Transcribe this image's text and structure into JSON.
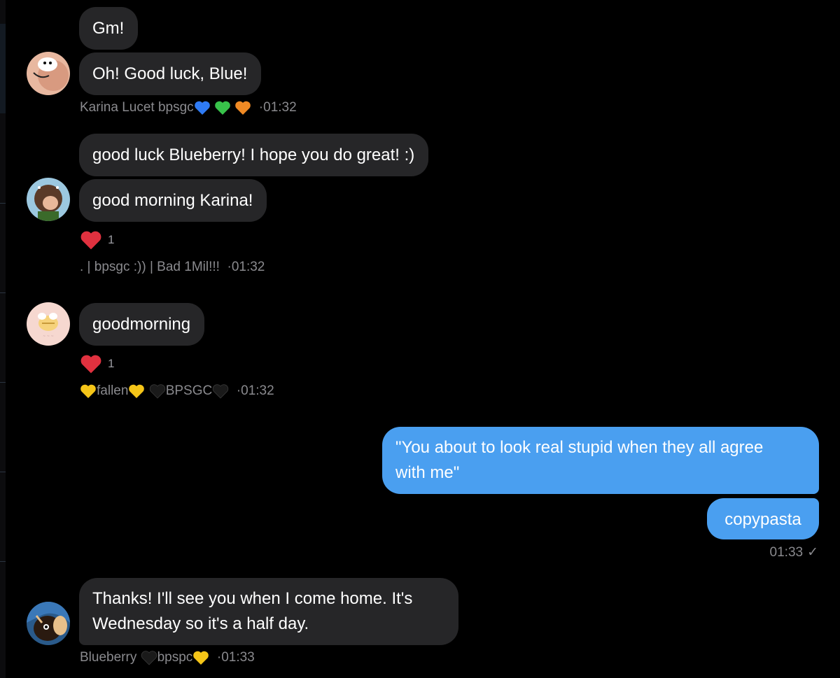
{
  "messages": [
    {
      "sender": "Karina Lucet bpsgc",
      "bubbles": [
        "Gm!",
        "Oh! Good luck, Blue!"
      ],
      "time": "01:32",
      "hearts": [
        "#2f7bf4",
        "#38c24a",
        "#f08a24"
      ]
    },
    {
      "sender": ". | bpsgc :)) | Bad 1Mil!!!",
      "bubbles": [
        "good luck Blueberry! I hope you do great! :)",
        "good morning Karina!"
      ],
      "reaction": {
        "emoji": "red-heart",
        "count": "1"
      },
      "time": "01:32"
    },
    {
      "sender_parts": [
        "fallen",
        "BPSGC"
      ],
      "bubbles": [
        "goodmorning"
      ],
      "reaction": {
        "emoji": "red-heart",
        "count": "1"
      },
      "time": "01:32"
    },
    {
      "outgoing": true,
      "bubbles": [
        "\"You about to look real stupid when they all agree",
        "with me\"",
        "copypasta"
      ],
      "time": "01:33",
      "status": "✓"
    },
    {
      "sender_parts": [
        "Blueberry",
        "bpspc"
      ],
      "bubbles": [
        "Thanks! I'll see you when I come home. It's",
        "Wednesday so it's a half day."
      ],
      "time": "01:33"
    }
  ],
  "colors": {
    "background": "#000000",
    "incoming_bubble": "#262628",
    "outgoing_bubble": "#4a9ff0",
    "meta_text": "#8a8a8e",
    "reaction_heart": "#e0313f",
    "yellow_heart": "#f5c518",
    "black_heart": "#1a1a1a"
  },
  "separator": "·"
}
